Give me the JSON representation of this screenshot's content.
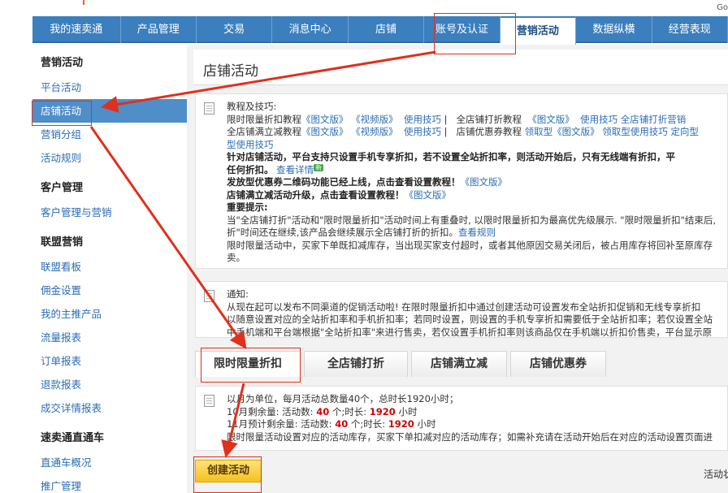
{
  "topbar": {
    "corner_text": "Go"
  },
  "nav": {
    "items": [
      "我的速卖通",
      "产品管理",
      "交易",
      "消息中心",
      "店铺",
      "账号及认证",
      "营销活动",
      "数据纵横",
      "经营表现"
    ],
    "active_index": 6
  },
  "sidebar": {
    "groups": [
      {
        "title": "营销活动",
        "items": [
          "平台活动",
          "店铺活动",
          "营销分组",
          "活动规则"
        ]
      },
      {
        "title": "客户管理",
        "items": [
          "客户管理与营销"
        ]
      },
      {
        "title": "联盟营销",
        "items": [
          "联盟看板",
          "佣金设置",
          "我的主推产品",
          "流量报表",
          "订单报表",
          "退款报表",
          "成交详情报表"
        ]
      },
      {
        "title": "速卖通直通车",
        "items": [
          "直通车概况",
          "推广管理"
        ]
      }
    ],
    "active_item": "店铺活动"
  },
  "page": {
    "title": "店铺活动"
  },
  "tutorial": {
    "heading": "教程及技巧:",
    "row1_a": "限时限量折扣教程",
    "row1_b": "《图文版》",
    "row1_c": "《视频版》",
    "row1_d": "使用技巧",
    "row1_e": "全店铺打折教程",
    "row1_f": "《图文版》",
    "row1_g": "使用技巧",
    "row1_h": "全店铺打折营销",
    "row2_a": "全店铺满立减教程",
    "row2_b": "《图文版》",
    "row2_c": "《视频版》",
    "row2_d": "使用技巧",
    "row2_e": "店铺优惠券教程",
    "row2_f": "领取型《图文版》",
    "row2_g": "领取型使用技巧",
    "row2_h": "定向型",
    "row3": "型使用技巧",
    "note1": "针对店铺活动，平台支持只设置手机专享折扣，若不设置全站折扣率，则活动开始后，只有无线端有折扣，平",
    "note1b": "任何折扣。",
    "note1_link": "查看详情",
    "new_badge": "新",
    "note2": "发放型优惠券二维码功能已经上线，点击查看设置教程！",
    "note2_link": "《图文版》",
    "note3": "店铺满立减活动升级，点击查看设置教程！",
    "note3_link": "《图文版》",
    "important": "重要提示:",
    "imp1": "当\"全店铺打折\"活动和\"限时限量折扣\"活动时间上有重叠时, 以限时限量折扣为最高优先级展示. \"限时限量折扣\"结束后,",
    "imp1b": "折\"时间还在继续,该产品会继续展示全店铺打折的折扣。",
    "imp1_link": "查看规则",
    "imp2": "限时限量活动中，买家下单既扣减库存，当出现买家支付超时，或者其他原因交易关闭后，被占用库存将回补至原库存",
    "imp2b": "卖。"
  },
  "notice": {
    "heading": "通知:",
    "line1": "从现在起可以发布不同渠道的促销活动啦! 在限时限量折扣中通过创建活动可设置发布全站折扣促销和无线专享折扣",
    "line2": "以随意设置对应的全站折扣率和手机折扣率；若同时设置，则设置的手机专享折扣需要低于全站折扣率；若仅设置全站",
    "line3": "中手机端和平台端根据\"全站折扣率\"来进行售卖，若仅设置手机折扣率则该商品仅在手机端以折扣价售卖，平台显示原"
  },
  "tabs": [
    "限时限量折扣",
    "全店铺打折",
    "店铺满立减",
    "店铺优惠券"
  ],
  "quota": {
    "line1": "以月为单位，每月活动总数量40个，总时长1920小时；",
    "l2_prefix": "10月剩余量: 活动数: ",
    "l2_count": "40",
    "l2_mid": " 个;时长: ",
    "l2_hours": "1920",
    "l2_suffix": " 小时",
    "l3_prefix": "11月预计剩余量: 活动数: ",
    "l3_count": "40",
    "l3_mid": " 个;时长: ",
    "l3_hours": "1920",
    "l3_suffix": " 小时",
    "line4": "限时限量活动设置对应的活动库存，买家下单扣减对应的活动库存；如需补充请在活动开始后在对应的活动设置页面进"
  },
  "actions": {
    "create_label": "创建活动",
    "right_label": "活动状"
  },
  "colors": {
    "nav_blue": "#3b7fbe",
    "link_blue": "#2a6db5",
    "annotation_red": "#e0301e",
    "button_yellow": "#f3c21e"
  }
}
